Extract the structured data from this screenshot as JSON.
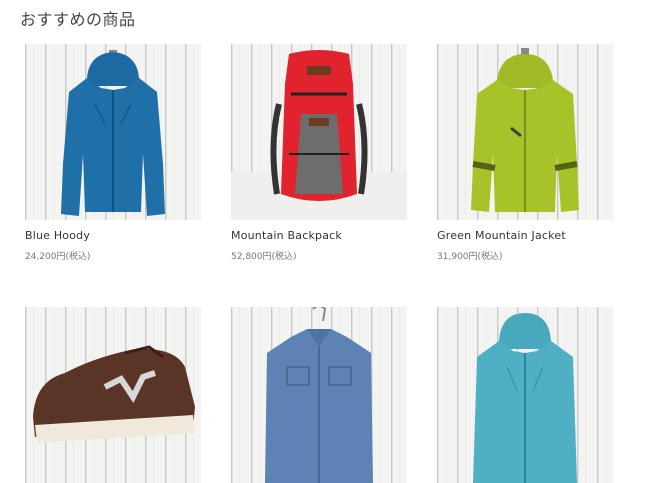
{
  "section": {
    "title": "おすすめの商品"
  },
  "products": [
    {
      "name": "Blue Hoody",
      "price": "24,200円(税込)",
      "image": "blue-hoody-image",
      "color": "#1f6fa8"
    },
    {
      "name": "Mountain Backpack",
      "price": "52,800円(税込)",
      "image": "red-backpack-image",
      "color": "#e0232c"
    },
    {
      "name": "Green Mountain Jacket",
      "price": "31,900円(税込)",
      "image": "green-jacket-image",
      "color": "#a7c32a"
    },
    {
      "name": "",
      "price": "",
      "image": "brown-sneaker-image",
      "color": "#5a3424"
    },
    {
      "name": "",
      "price": "",
      "image": "chambray-shirt-image",
      "color": "#5d82b4"
    },
    {
      "name": "",
      "price": "",
      "image": "teal-jacket-image",
      "color": "#4fb0c4"
    }
  ]
}
